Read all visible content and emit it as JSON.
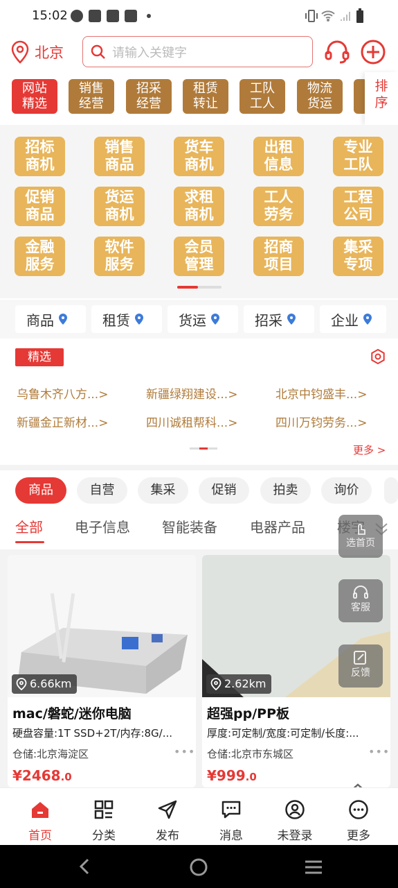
{
  "status_bar": {
    "time": "15:02"
  },
  "header": {
    "city": "北京",
    "search_placeholder": "请输入关键字"
  },
  "top_categories": {
    "items": [
      "网站\n精选",
      "销售\n经营",
      "招采\n经营",
      "租赁\n转让",
      "工队\n工人",
      "物流\n货运"
    ],
    "sort_label": "排\n序"
  },
  "grid": {
    "items": [
      "招标\n商机",
      "销售\n商品",
      "货车\n商机",
      "出租\n信息",
      "专业\n工队",
      "促销\n商品",
      "货运\n商机",
      "求租\n商机",
      "工人\n劳务",
      "工程\n公司",
      "金融\n服务",
      "软件\n服务",
      "会员\n管理",
      "招商\n项目",
      "集采\n专项"
    ]
  },
  "map_tabs": [
    "商品",
    "租赁",
    "货运",
    "招采",
    "企业"
  ],
  "featured": {
    "badge": "精选",
    "links": [
      "乌鲁木齐八方...>",
      "新疆绿翔建设...>",
      "北京中钧盛丰...>",
      "新疆金正新材...>",
      "四川诚租帮科...>",
      "四川万钧劳务...>"
    ],
    "more": "更多 >"
  },
  "chips": [
    "商品",
    "自营",
    "集采",
    "促销",
    "拍卖",
    "询价"
  ],
  "subcategories": [
    "全部",
    "电子信息",
    "智能装备",
    "电器产品",
    "楼宇"
  ],
  "products": [
    {
      "distance": "6.66km",
      "title": "mac/磐蛇/迷你电脑",
      "spec": "硬盘容量:1T SSD+2T/内存:8G/...",
      "store": "仓储:北京海淀区",
      "price": "¥2468",
      "price_dec": ".0"
    },
    {
      "distance": "2.62km",
      "title": "超强pp/PP板",
      "spec": "厚度:可定制/宽度:可定制/长度:...",
      "store": "仓储:北京市东城区",
      "price": "¥999",
      "price_dec": ".0"
    }
  ],
  "floating": {
    "home": "选首页",
    "service": "客服",
    "feedback": "反馈"
  },
  "bottom_nav": [
    "首页",
    "分类",
    "发布",
    "消息",
    "未登录",
    "更多"
  ],
  "colors": {
    "accent": "#e53935",
    "gold": "#e8b55a",
    "brown": "#b07b3a"
  }
}
